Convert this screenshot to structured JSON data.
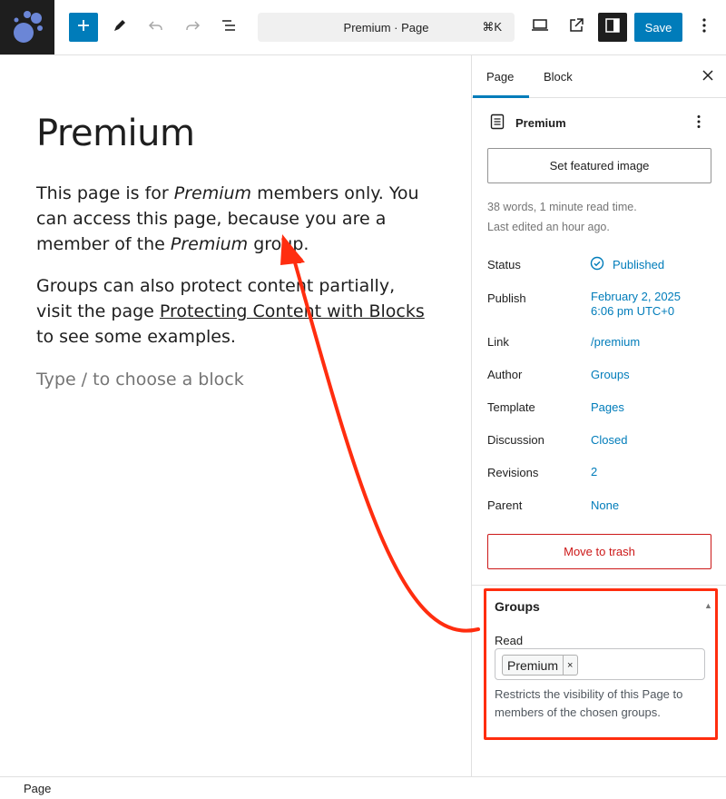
{
  "topbar": {
    "command_title": "Premium · Page",
    "command_shortcut": "⌘K",
    "save_label": "Save"
  },
  "editor": {
    "title": "Premium",
    "paragraph1": {
      "a": "This page is for ",
      "b": "Premium",
      "c": " members only. You can access this page, because you are a member of the ",
      "d": "Premium",
      "e": " group."
    },
    "paragraph2": {
      "a": "Groups can also protect content partially, visit the page ",
      "link": "Protecting Content with Blocks",
      "c": " to see some examples."
    },
    "placeholder": "Type / to choose a block"
  },
  "sidebar": {
    "tabs": [
      "Page",
      "Block"
    ],
    "document_title": "Premium",
    "featured_image_button": "Set featured image",
    "meta_line1": "38 words, 1 minute read time.",
    "meta_line2": "Last edited an hour ago.",
    "rows": [
      {
        "label": "Status",
        "value": "Published"
      },
      {
        "label": "Publish",
        "value": "February 2, 2025",
        "value2": "6:06 pm UTC+0"
      },
      {
        "label": "Link",
        "value": "/premium"
      },
      {
        "label": "Author",
        "value": "Groups"
      },
      {
        "label": "Template",
        "value": "Pages"
      },
      {
        "label": "Discussion",
        "value": "Closed"
      },
      {
        "label": "Revisions",
        "value": "2"
      },
      {
        "label": "Parent",
        "value": "None"
      }
    ],
    "trash_button": "Move to trash",
    "groups": {
      "title": "Groups",
      "read_label": "Read",
      "chip": "Premium",
      "chip_remove": "×",
      "help": "Restricts the visibility of this Page to members of the chosen groups."
    }
  },
  "statusbar": {
    "label": "Page"
  },
  "colors": {
    "accent": "#007cba",
    "annotation": "#ff2d0f",
    "danger": "#cc1818"
  }
}
